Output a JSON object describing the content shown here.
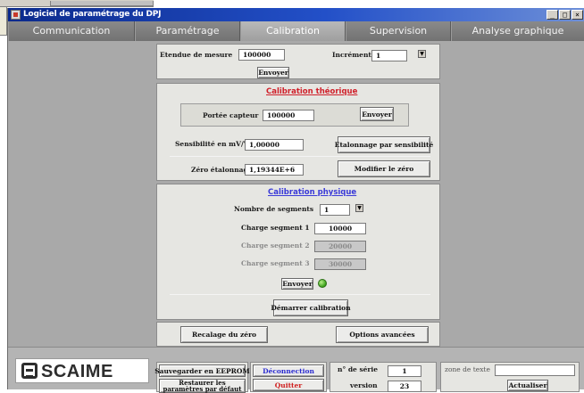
{
  "window": {
    "title": "Logiciel de paramétrage du DPJ",
    "controls": [
      "_",
      "□",
      "×"
    ]
  },
  "tabs": [
    {
      "label": "Communication",
      "active": false
    },
    {
      "label": "Paramétrage",
      "active": false
    },
    {
      "label": "Calibration",
      "active": true
    },
    {
      "label": "Supervision",
      "active": false
    },
    {
      "label": "Analyse graphique",
      "active": false
    }
  ],
  "measure": {
    "range_label": "Etendue de mesure",
    "range_value": "100000",
    "increment_label": "Incrément",
    "increment_value": "1",
    "send_label": "Envoyer"
  },
  "theoretical": {
    "title": "Calibration théorique",
    "title_color": "#d0202a",
    "sensor_range_label": "Portée capteur",
    "sensor_range_value": "100000",
    "send_label": "Envoyer",
    "sensitivity_label": "Sensibilité en mV/V",
    "sensitivity_value": "1,00000",
    "sensitivity_button": "Etalonnage par sensibilité",
    "zero_label": "Zéro étalonnage",
    "zero_value": "1,19344E+6",
    "zero_button": "Modifier le zéro"
  },
  "physical": {
    "title": "Calibration physique",
    "title_color": "#3a3ad8",
    "segments_label": "Nombre de segments",
    "segments_value": "1",
    "segments": [
      {
        "label": "Charge segment 1",
        "value": "10000",
        "enabled": true
      },
      {
        "label": "Charge segment 2",
        "value": "20000",
        "enabled": false
      },
      {
        "label": "Charge segment 3",
        "value": "30000",
        "enabled": false
      }
    ],
    "send_label": "Envoyer",
    "status_color": "#3aa019",
    "start_button": "Démarrer calibration"
  },
  "actions": {
    "zero_reset": "Recalage du zéro",
    "advanced": "Options avancées"
  },
  "bottom": {
    "logo_text": "SCAIME",
    "save_eeprom": "Sauvegarder en EEPROM",
    "restore_defaults": "Restaurer les paramètres par défaut",
    "disconnect": "Déconnection",
    "disconnect_color": "#2a2ad0",
    "quit": "Quitter",
    "quit_color": "#d02020",
    "serial_label": "n° de série",
    "serial_value": "1",
    "version_label": "version",
    "version_value": "23",
    "text_zone_label": "zone de texte",
    "text_zone_value": "",
    "refresh": "Actualiser"
  }
}
